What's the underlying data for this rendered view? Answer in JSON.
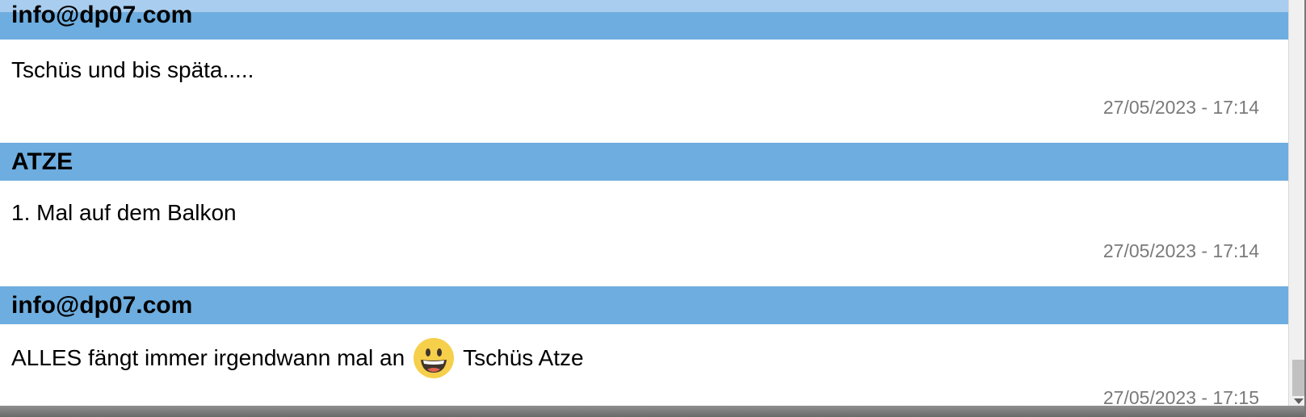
{
  "messages": [
    {
      "author": "info@dp07.com",
      "text": "Tschüs und bis späta.....",
      "timestamp": "27/05/2023 - 17:14"
    },
    {
      "author": "ATZE",
      "text": "1. Mal auf dem Balkon",
      "timestamp": "27/05/2023 - 17:14"
    },
    {
      "author": "info@dp07.com",
      "text_before_emoji": "ALLES fängt immer irgendwann mal an",
      "emoji": "grinning-face-emoji",
      "text_after_emoji": "Tschüs Atze",
      "timestamp": "27/05/2023 - 17:15"
    }
  ],
  "colors": {
    "header_bg": "#6eaddf",
    "top_strip": "#a9cdee",
    "timestamp": "#7a7a7a"
  }
}
